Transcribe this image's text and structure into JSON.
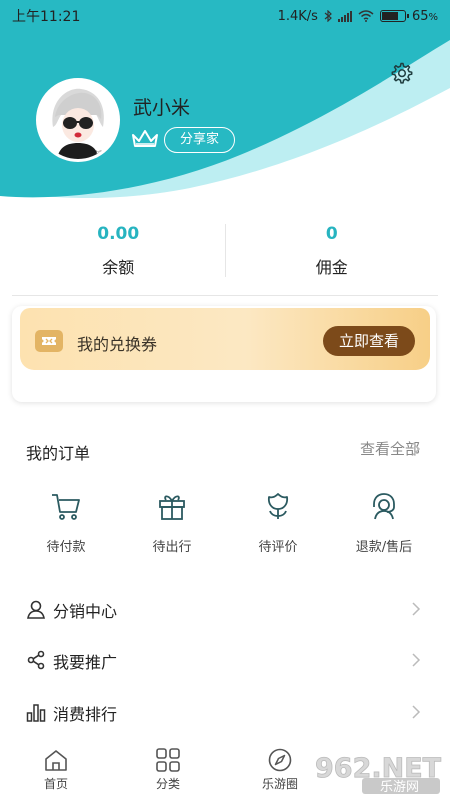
{
  "status_bar": {
    "time": "上午11:21",
    "speed": "1.4K/s",
    "battery": "65",
    "battery_unit": "%",
    "battery_level": 0.65
  },
  "profile": {
    "name": "武小米",
    "role_badge": "分享家",
    "avatar_signature": "bfi"
  },
  "stats": [
    {
      "value": "0.00",
      "label": "余额"
    },
    {
      "value": "0",
      "label": "佣金"
    }
  ],
  "voucher": {
    "label": "我的兑换券",
    "button": "立即查看"
  },
  "orders": {
    "title": "我的订单",
    "view_all": "查看全部",
    "items": [
      {
        "label": "待付款",
        "icon": "cart-icon"
      },
      {
        "label": "待出行",
        "icon": "gift-icon"
      },
      {
        "label": "待评价",
        "icon": "tulip-icon"
      },
      {
        "label": "退款/售后",
        "icon": "headset-icon"
      }
    ]
  },
  "menu": [
    {
      "label": "分销中心",
      "icon": "user-icon"
    },
    {
      "label": "我要推广",
      "icon": "share-icon"
    },
    {
      "label": "消费排行",
      "icon": "bar-chart-icon"
    }
  ],
  "tabs": [
    {
      "label": "首页",
      "icon": "home-icon"
    },
    {
      "label": "分类",
      "icon": "grid-icon"
    },
    {
      "label": "乐游圈",
      "icon": "compass-icon"
    }
  ],
  "watermark": {
    "main": "962.NET",
    "sub": "乐游网"
  },
  "colors": {
    "accent": "#27b4c0",
    "voucher_button": "#7c4a1a",
    "header_light": "#bdeef2"
  }
}
